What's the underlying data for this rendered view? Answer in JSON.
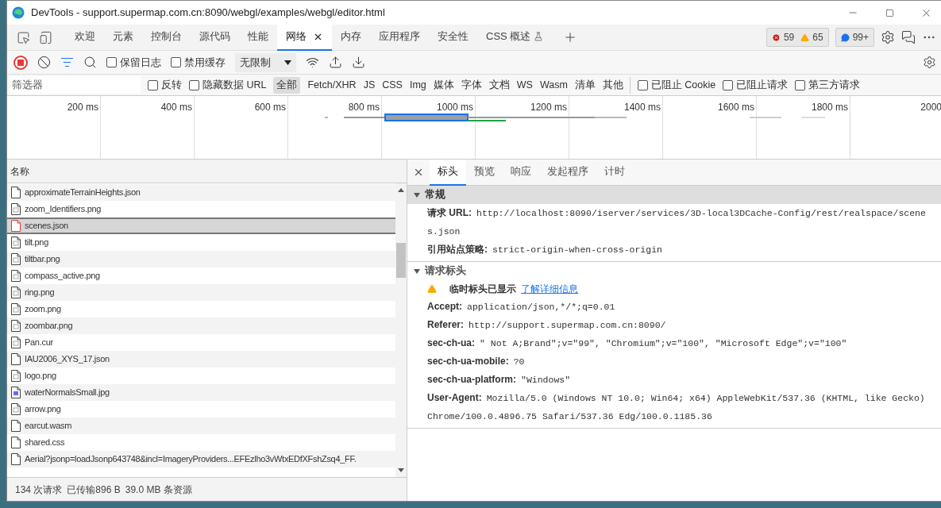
{
  "window": {
    "title": "DevTools - support.supermap.com.cn:8090/webgl/examples/webgl/editor.html"
  },
  "tabs": [
    {
      "label": "欢迎",
      "selected": false,
      "experimental": false
    },
    {
      "label": "元素",
      "selected": false,
      "experimental": false
    },
    {
      "label": "控制台",
      "selected": false,
      "experimental": false
    },
    {
      "label": "源代码",
      "selected": false,
      "experimental": false
    },
    {
      "label": "性能",
      "selected": false,
      "experimental": false
    },
    {
      "label": "网络",
      "selected": true,
      "experimental": false
    },
    {
      "label": "内存",
      "selected": false,
      "experimental": false
    },
    {
      "label": "应用程序",
      "selected": false,
      "experimental": false
    },
    {
      "label": "安全性",
      "selected": false,
      "experimental": false
    },
    {
      "label": "CSS 概述",
      "selected": false,
      "experimental": true
    }
  ],
  "counters": {
    "errors": "59",
    "warnings": "65",
    "messages": "99+"
  },
  "toolbar": {
    "recording": true,
    "checkboxes": [
      {
        "label": "保留日志",
        "checked": false
      },
      {
        "label": "禁用缓存",
        "checked": false
      }
    ],
    "throttling": "无限制"
  },
  "filter_bar": {
    "placeholder": "筛选器",
    "checkboxes": [
      {
        "label": "反转",
        "checked": false
      },
      {
        "label": "隐藏数据 URL",
        "checked": false
      }
    ],
    "types": [
      {
        "label": "全部",
        "selected": true
      },
      {
        "label": "Fetch/XHR",
        "selected": false
      },
      {
        "label": "JS",
        "selected": false
      },
      {
        "label": "CSS",
        "selected": false
      },
      {
        "label": "Img",
        "selected": false
      },
      {
        "label": "媒体",
        "selected": false
      },
      {
        "label": "字体",
        "selected": false
      },
      {
        "label": "文档",
        "selected": false
      },
      {
        "label": "WS",
        "selected": false
      },
      {
        "label": "Wasm",
        "selected": false
      },
      {
        "label": "清单",
        "selected": false
      },
      {
        "label": "其他",
        "selected": false
      }
    ],
    "extra_checkboxes": [
      {
        "label": "已阻止 Cookie",
        "checked": false
      },
      {
        "label": "已阻止请求",
        "checked": false
      },
      {
        "label": "第三方请求",
        "checked": false
      }
    ]
  },
  "timeline": {
    "ticks": [
      "200 ms",
      "400 ms",
      "600 ms",
      "800 ms",
      "1000 ms",
      "1200 ms",
      "1400 ms",
      "1600 ms",
      "1800 ms",
      "2000"
    ]
  },
  "requests": {
    "column": "名称",
    "rows": [
      {
        "name": "approximateTerrainHeights.json",
        "kind": "document",
        "selected": false,
        "failed": false
      },
      {
        "name": "zoom_Identifiers.png",
        "kind": "image",
        "selected": false,
        "failed": false
      },
      {
        "name": "scenes.json",
        "kind": "document",
        "selected": true,
        "failed": true
      },
      {
        "name": "tilt.png",
        "kind": "image",
        "selected": false,
        "failed": false
      },
      {
        "name": "tiltbar.png",
        "kind": "image",
        "selected": false,
        "failed": false
      },
      {
        "name": "compass_active.png",
        "kind": "image",
        "selected": false,
        "failed": false
      },
      {
        "name": "ring.png",
        "kind": "image",
        "selected": false,
        "failed": false
      },
      {
        "name": "zoom.png",
        "kind": "image",
        "selected": false,
        "failed": false
      },
      {
        "name": "zoombar.png",
        "kind": "image",
        "selected": false,
        "failed": false
      },
      {
        "name": "Pan.cur",
        "kind": "image",
        "selected": false,
        "failed": false
      },
      {
        "name": "IAU2006_XYS_17.json",
        "kind": "document",
        "selected": false,
        "failed": false
      },
      {
        "name": "logo.png",
        "kind": "image",
        "selected": false,
        "failed": false
      },
      {
        "name": "waterNormalsSmall.jpg",
        "kind": "photo",
        "selected": false,
        "failed": false
      },
      {
        "name": "arrow.png",
        "kind": "image",
        "selected": false,
        "failed": false
      },
      {
        "name": "earcut.wasm",
        "kind": "document",
        "selected": false,
        "failed": false
      },
      {
        "name": "shared.css",
        "kind": "document",
        "selected": false,
        "failed": false
      },
      {
        "name": "Aerial?jsonp=loadJsonp643748&incl=ImageryProviders...EFEzlho3vWtxEDfXFshZsq4_FF.",
        "kind": "document",
        "selected": false,
        "failed": false
      }
    ]
  },
  "status_bar": [
    "134 次请求",
    "已传输896 B",
    "39.0 MB 条资源"
  ],
  "detail_tabs": [
    {
      "label": "标头",
      "selected": true
    },
    {
      "label": "预览",
      "selected": false
    },
    {
      "label": "响应",
      "selected": false
    },
    {
      "label": "发起程序",
      "selected": false
    },
    {
      "label": "计时",
      "selected": false
    }
  ],
  "sections": [
    {
      "title": "常规",
      "expanded": true,
      "highlighted": true,
      "rows": [
        {
          "key": "请求 URL:",
          "value": "http://localhost:8090/iserver/services/3D-local3DCache-Config/rest/realspace/scenes.json"
        },
        {
          "key": "引用站点策略:",
          "value": "strict-origin-when-cross-origin"
        }
      ]
    },
    {
      "title": "请求标头",
      "expanded": true,
      "highlighted": false,
      "notice": {
        "text": "临时标头已显示",
        "link": "了解详细信息"
      },
      "rows": [
        {
          "key": "Accept:",
          "value": "application/json,*/*;q=0.01"
        },
        {
          "key": "Referer:",
          "value": "http://support.supermap.com.cn:8090/"
        },
        {
          "key": "sec-ch-ua:",
          "value": "\" Not A;Brand\";v=\"99\", \"Chromium\";v=\"100\", \"Microsoft Edge\";v=\"100\""
        },
        {
          "key": "sec-ch-ua-mobile:",
          "value": "?0"
        },
        {
          "key": "sec-ch-ua-platform:",
          "value": "\"Windows\""
        },
        {
          "key": "User-Agent:",
          "value": "Mozilla/5.0 (Windows NT 10.0; Win64; x64) AppleWebKit/537.36 (KHTML, like Gecko) Chrome/100.0.4896.75 Safari/537.36 Edg/100.0.1185.36"
        }
      ]
    }
  ]
}
